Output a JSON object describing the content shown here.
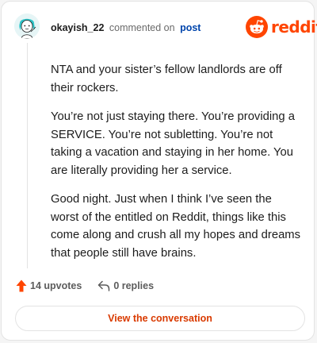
{
  "comment": {
    "username": "okayish_22",
    "action_text": "commented on",
    "post_link_text": "post",
    "paragraphs": [
      "NTA and your sister’s fellow landlords are off their rockers.",
      "You’re not just staying there. You’re providing a SERVICE. You’re not subletting. You’re not taking a vacation and staying in her home. You are literally providing her a service.",
      "Good night. Just when I think I’ve seen the worst of the entitled on Reddit, things like this come along and crush all my hopes and dreams that people still have brains."
    ]
  },
  "brand": {
    "name": "reddit",
    "color": "#ff4500"
  },
  "actions": {
    "upvotes_label": "14 upvotes",
    "replies_label": "0 replies",
    "upvote_color": "#ff4500"
  },
  "footer": {
    "view_label": "View the conversation",
    "link_color": "#d93a00"
  },
  "icons": {
    "avatar": "avatar-icon",
    "logo": "reddit-logo-icon",
    "upvote": "upvote-arrow-icon",
    "reply": "reply-arrow-icon"
  }
}
